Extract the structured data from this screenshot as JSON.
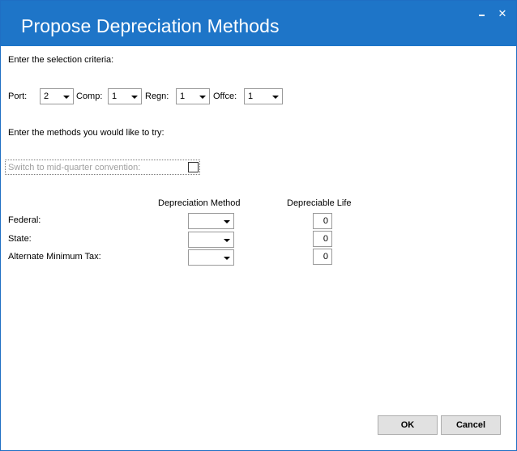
{
  "window": {
    "title": "Propose Depreciation Methods",
    "minimize_glyph": "_",
    "close_glyph": "✕"
  },
  "criteria": {
    "prompt": "Enter the selection criteria:",
    "fields": [
      {
        "label": "Port:",
        "value": "2"
      },
      {
        "label": "Comp:",
        "value": "1"
      },
      {
        "label": "Regn:",
        "value": "1"
      },
      {
        "label": "Offce:",
        "value": "1"
      }
    ]
  },
  "methods": {
    "prompt": "Enter the methods you would like to try:",
    "mid_quarter_label": "Switch to mid-quarter convention:",
    "mid_quarter_checked": false,
    "col_method": "Depreciation Method",
    "col_life": "Depreciable Life",
    "rows": [
      {
        "label": "Federal:",
        "method": "",
        "life": "0"
      },
      {
        "label": "State:",
        "method": "",
        "life": "0"
      },
      {
        "label": "Alternate Minimum Tax:",
        "method": "",
        "life": "0"
      }
    ]
  },
  "buttons": {
    "ok": "OK",
    "cancel": "Cancel"
  },
  "colors": {
    "titlebar": "#1e75c8",
    "button_face": "#e1e1e1"
  }
}
